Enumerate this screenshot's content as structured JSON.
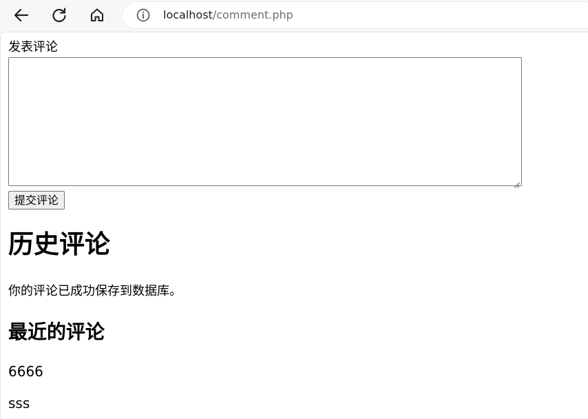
{
  "browser": {
    "url_host": "localhost",
    "url_path": "/comment.php",
    "icons": [
      "back-arrow-icon",
      "reload-icon",
      "home-icon",
      "info-icon"
    ]
  },
  "form": {
    "label": "发表评论",
    "textarea_value": "",
    "submit_label": "提交评论"
  },
  "history": {
    "title": "历史评论",
    "status": "你的评论已成功保存到数据库。",
    "recent_title": "最近的评论",
    "comments": [
      "6666",
      "sss"
    ]
  }
}
